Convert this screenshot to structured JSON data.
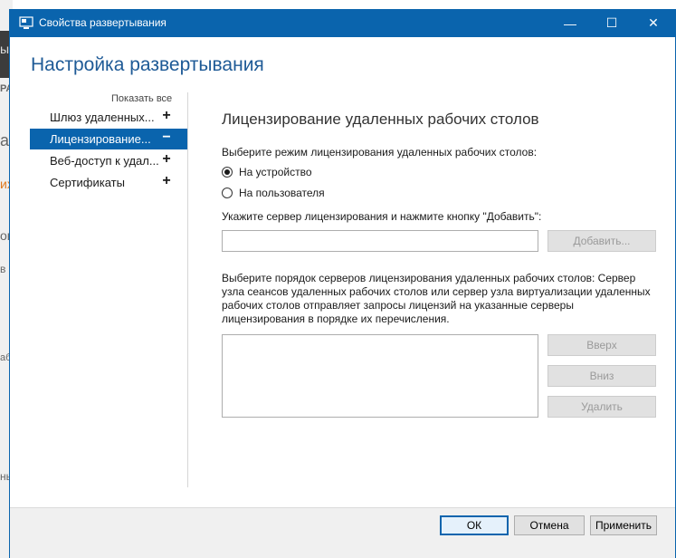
{
  "background": {
    "fragments": [
      "ых",
      "РА",
      "ас",
      "их",
      "ов",
      "в",
      "аб",
      "нь"
    ]
  },
  "window": {
    "title": "Свойства развертывания",
    "controls": {
      "minimize": "—",
      "maximize": "☐",
      "close": "✕"
    }
  },
  "heading": "Настройка развертывания",
  "nav": {
    "show_all": "Показать все",
    "items": [
      {
        "label": "Шлюз удаленных...",
        "sign": "+",
        "selected": false
      },
      {
        "label": "Лицензирование...",
        "sign": "−",
        "selected": true
      },
      {
        "label": "Веб-доступ к удал...",
        "sign": "+",
        "selected": false
      },
      {
        "label": "Сертификаты",
        "sign": "+",
        "selected": false
      }
    ]
  },
  "licensing": {
    "title": "Лицензирование удаленных рабочих столов",
    "mode_label": "Выберите режим лицензирования удаленных рабочих столов:",
    "modes": [
      {
        "label": "На устройство",
        "checked": true
      },
      {
        "label": "На пользователя",
        "checked": false
      }
    ],
    "server_label": "Укажите сервер лицензирования и нажмите кнопку \"Добавить\":",
    "server_value": "",
    "add_button": "Добавить...",
    "order_text": "Выберите порядок серверов лицензирования удаленных рабочих столов: Сервер узла сеансов удаленных рабочих столов или сервер узла виртуализации удаленных рабочих столов отправляет запросы лицензий на указанные серверы лицензирования в порядке их перечисления.",
    "servers": [],
    "up_button": "Вверх",
    "down_button": "Вниз",
    "remove_button": "Удалить"
  },
  "footer": {
    "ok": "ОК",
    "cancel": "Отмена",
    "apply": "Применить"
  },
  "colors": {
    "accent": "#0a64ad",
    "heading": "#1e5a96"
  }
}
